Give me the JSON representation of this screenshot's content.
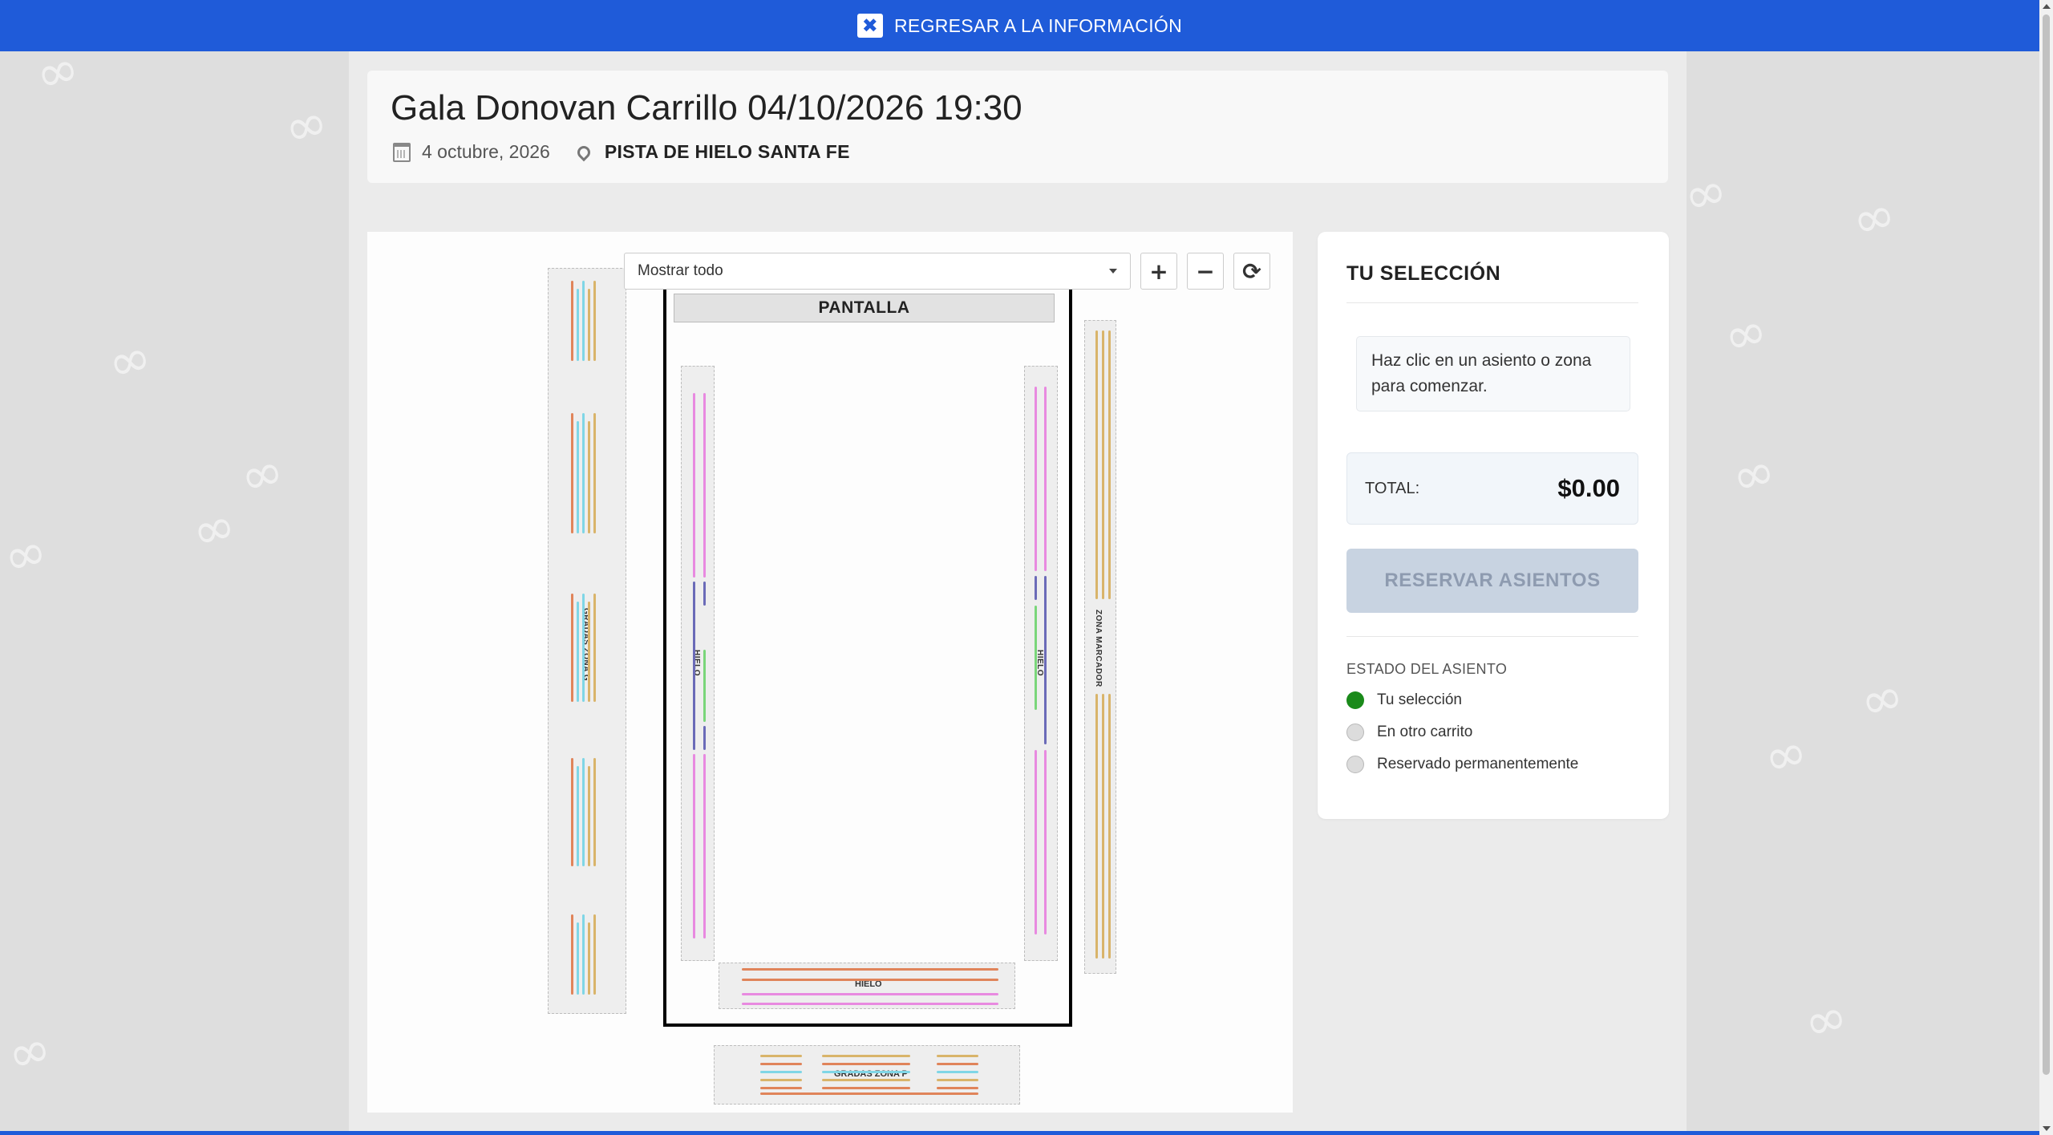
{
  "top_bar": {
    "label": "REGRESAR A LA INFORMACIÓN",
    "close_glyph": "✖"
  },
  "event": {
    "title": "Gala Donovan Carrillo 04/10/2026 19:30",
    "date": "4 octubre, 2026",
    "venue": "PISTA DE HIELO SANTA FE"
  },
  "map": {
    "filter_value": "Mostrar todo",
    "zoom_in_glyph": "+",
    "zoom_out_glyph": "−",
    "reset_glyph": "⟳",
    "screen_label": "PANTALLA",
    "zones": {
      "gradas_g": "GRADAS ZONA G",
      "hielo_left": "HIELO",
      "hielo_right": "HIELO",
      "hielo_bottom": "HIELO",
      "marcador": "ZONA MARCADOR",
      "gradas_p": "GRADAS ZONA P"
    }
  },
  "selection": {
    "title": "TU SELECCIÓN",
    "hint": "Haz clic en un asiento o zona para comenzar.",
    "total_label": "TOTAL:",
    "total_value": "$0.00",
    "reserve_label": "RESERVAR ASIENTOS",
    "legend_title": "ESTADO DEL ASIENTO",
    "legend": [
      {
        "label": "Tu selección",
        "color": "#1a8a1a"
      },
      {
        "label": "En otro carrito",
        "color": "#dcdcdc"
      },
      {
        "label": "Reservado permanentemente",
        "color": "#dcdcdc"
      }
    ]
  },
  "colors": {
    "accent": "#1f5bd9",
    "seat_cyan": "#7fd6e6",
    "seat_gold": "#d9b46a",
    "seat_orange": "#e0845a",
    "seat_pink": "#e88ae0",
    "seat_indigo": "#6b6bb8",
    "seat_green": "#7ad67a"
  }
}
